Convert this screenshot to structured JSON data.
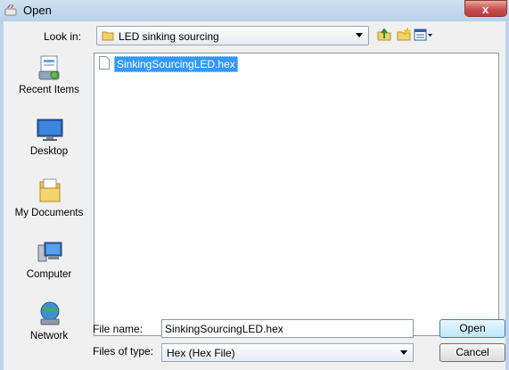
{
  "window": {
    "title": "Open",
    "close_label": "x"
  },
  "lookin": {
    "label": "Look in:",
    "value": "LED sinking sourcing"
  },
  "toolbar": {
    "icons": [
      "up-folder-icon",
      "new-folder-icon",
      "view-menu-icon"
    ]
  },
  "places": [
    {
      "label": "Recent Items",
      "icon": "recent-items-icon"
    },
    {
      "label": "Desktop",
      "icon": "desktop-icon"
    },
    {
      "label": "My Documents",
      "icon": "my-documents-icon"
    },
    {
      "label": "Computer",
      "icon": "computer-icon"
    },
    {
      "label": "Network",
      "icon": "network-icon"
    }
  ],
  "files": [
    {
      "name": "SinkingSourcingLED.hex",
      "selected": true
    }
  ],
  "filename": {
    "label": "File name:",
    "value": "SinkingSourcingLED.hex"
  },
  "filetype": {
    "label": "Files of type:",
    "value": "Hex (Hex File)"
  },
  "buttons": {
    "open": "Open",
    "cancel": "Cancel"
  },
  "colors": {
    "selection": "#3399ff",
    "titlebar": "#b9d1ea"
  }
}
